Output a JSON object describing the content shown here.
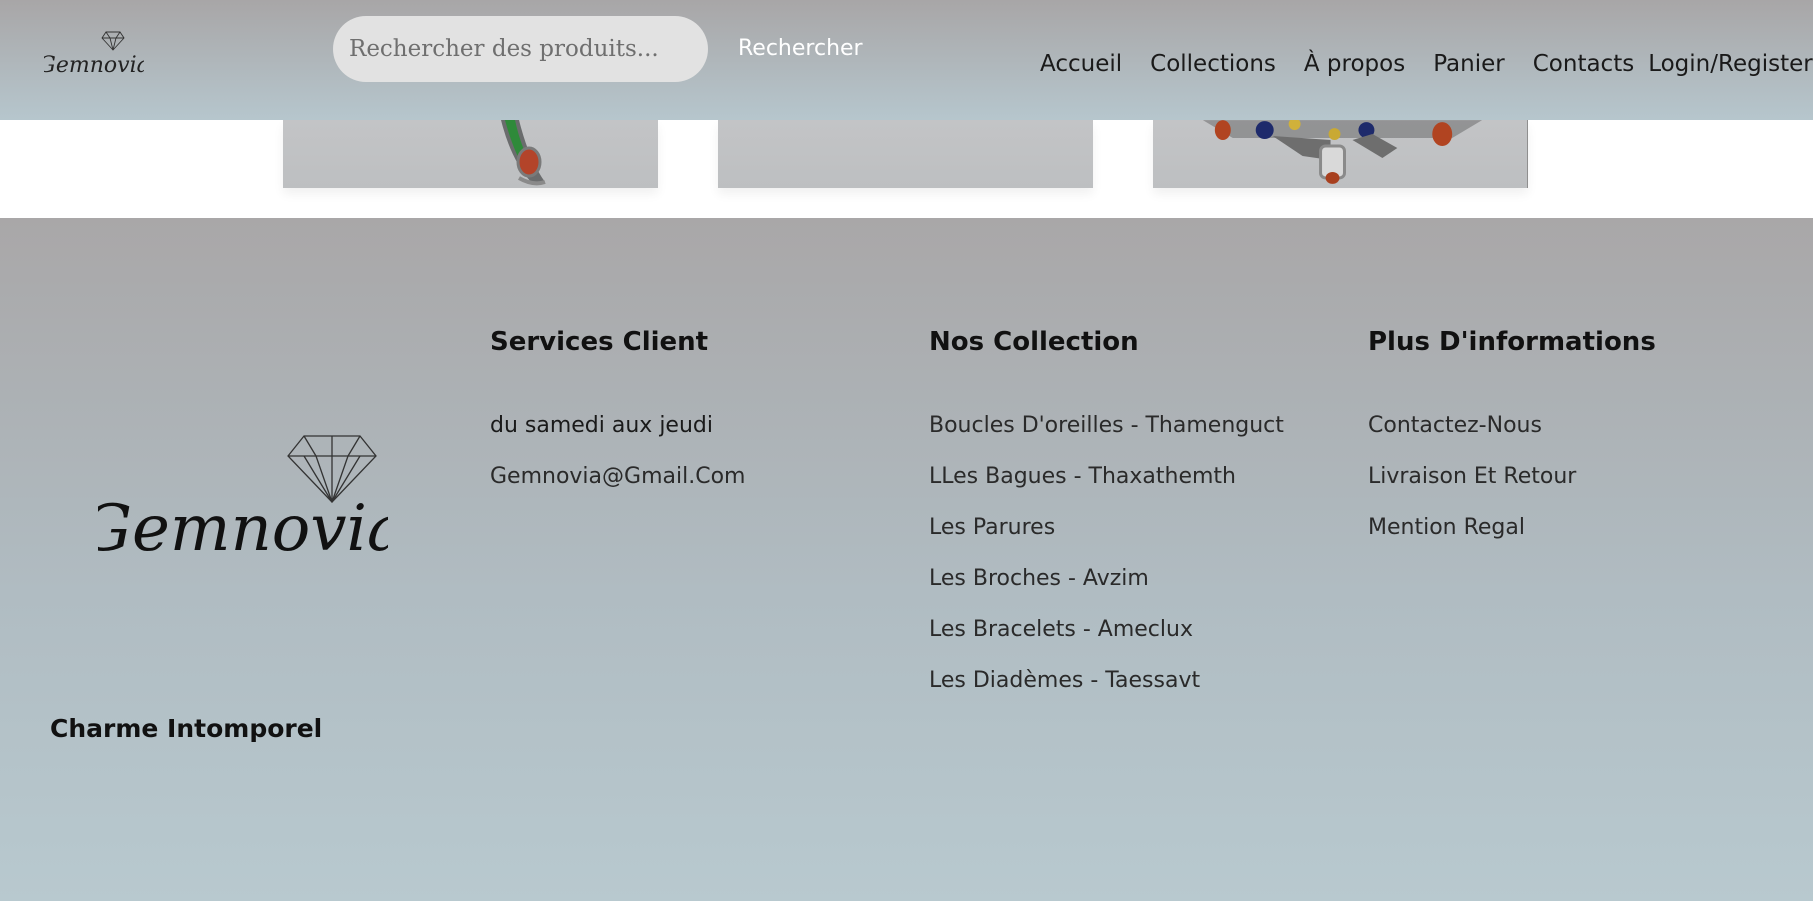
{
  "colors": {
    "header_gradient": [
      "#a8a6a7",
      "#b6c6cd"
    ],
    "footer_gradient": [
      "#a9a7a8",
      "#b8c9cf"
    ],
    "search_bg": "#e2e2e2",
    "search_button_text": "#ffffff"
  },
  "header": {
    "logo_icon": "gemnovia-logo-icon",
    "search": {
      "placeholder": "Rechercher des produits...",
      "value": "",
      "button_label": "Rechercher"
    },
    "nav": [
      "Accueil",
      "Collections",
      "À propos",
      "Panier",
      "Contacts",
      "Login/Register"
    ]
  },
  "products": [
    {
      "image": "bracelet-photo"
    },
    {
      "image": "jewelry-photo"
    },
    {
      "image": "brooch-photo"
    }
  ],
  "footer": {
    "logo_icon": "gemnovia-logo-icon",
    "tagline": "Charme Intomporel",
    "columns": [
      {
        "title": "Services Client",
        "items": [
          "du samedi aux jeudi",
          "Gemnovia@Gmail.Com"
        ]
      },
      {
        "title": "Nos Collection",
        "items": [
          "Boucles D'oreilles - Thamenguct",
          "LLes Bagues - Thaxathemth",
          "Les Parures",
          "Les Broches - Avzim",
          "Les Bracelets - Ameclux",
          "Les Diadèmes - Taessavt"
        ]
      },
      {
        "title": "Plus D'informations",
        "items": [
          "Contactez-Nous",
          "Livraison Et Retour",
          "Mention Regal"
        ]
      }
    ]
  }
}
